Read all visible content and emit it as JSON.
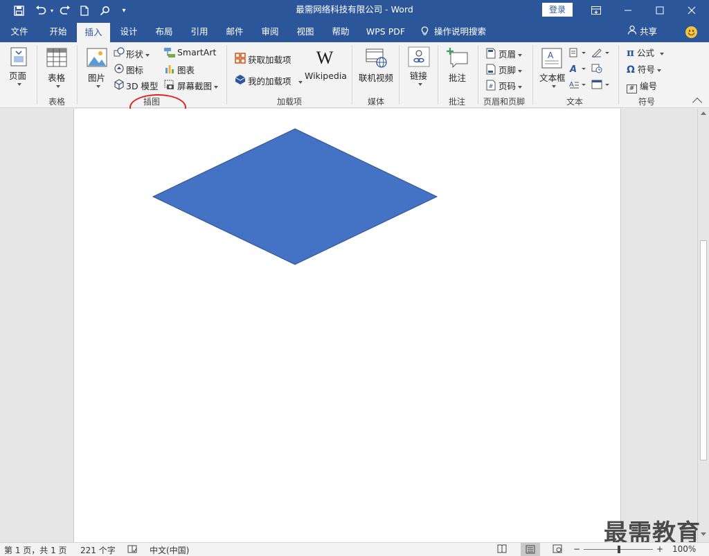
{
  "titlebar": {
    "title": "最需网络科技有限公司  -  Word",
    "login": "登录"
  },
  "tabs": [
    "文件",
    "开始",
    "插入",
    "设计",
    "布局",
    "引用",
    "邮件",
    "审阅",
    "视图",
    "帮助",
    "WPS PDF"
  ],
  "tell_me": "操作说明搜索",
  "share": "共享",
  "ribbon": {
    "pages": {
      "label": "页面",
      "group": ""
    },
    "tables": {
      "label": "表格",
      "group": "表格"
    },
    "illustrations": {
      "picture": "图片",
      "shapes": "形状",
      "icons": "图标",
      "model3d": "3D 模型",
      "smartart": "SmartArt",
      "chart": "图表",
      "screenshot": "屏幕截图",
      "group": "插图"
    },
    "addins": {
      "get": "获取加载项",
      "mine": "我的加载项",
      "wikipedia": "Wikipedia",
      "group": "加载项"
    },
    "media": {
      "video": "联机视频",
      "group": "媒体"
    },
    "links": {
      "link": "链接"
    },
    "comments": {
      "comment": "批注",
      "group": "批注"
    },
    "headerfooter": {
      "header": "页眉",
      "footer": "页脚",
      "pagenum": "页码",
      "group": "页眉和页脚"
    },
    "text": {
      "textbox": "文本框",
      "group": "文本"
    },
    "symbols": {
      "equation": "公式",
      "symbol": "符号",
      "number": "编号",
      "group": "符号"
    }
  },
  "document": {
    "shape_color": "#4472c4",
    "shape_stroke": "#2f528f"
  },
  "watermark": "最需教育",
  "status": {
    "page": "第 1 页，共 1 页",
    "words": "221 个字",
    "language": "中文(中国)",
    "zoom": "100%"
  },
  "colors": {
    "accent": "#2b579a",
    "annotation": "#e02020"
  }
}
